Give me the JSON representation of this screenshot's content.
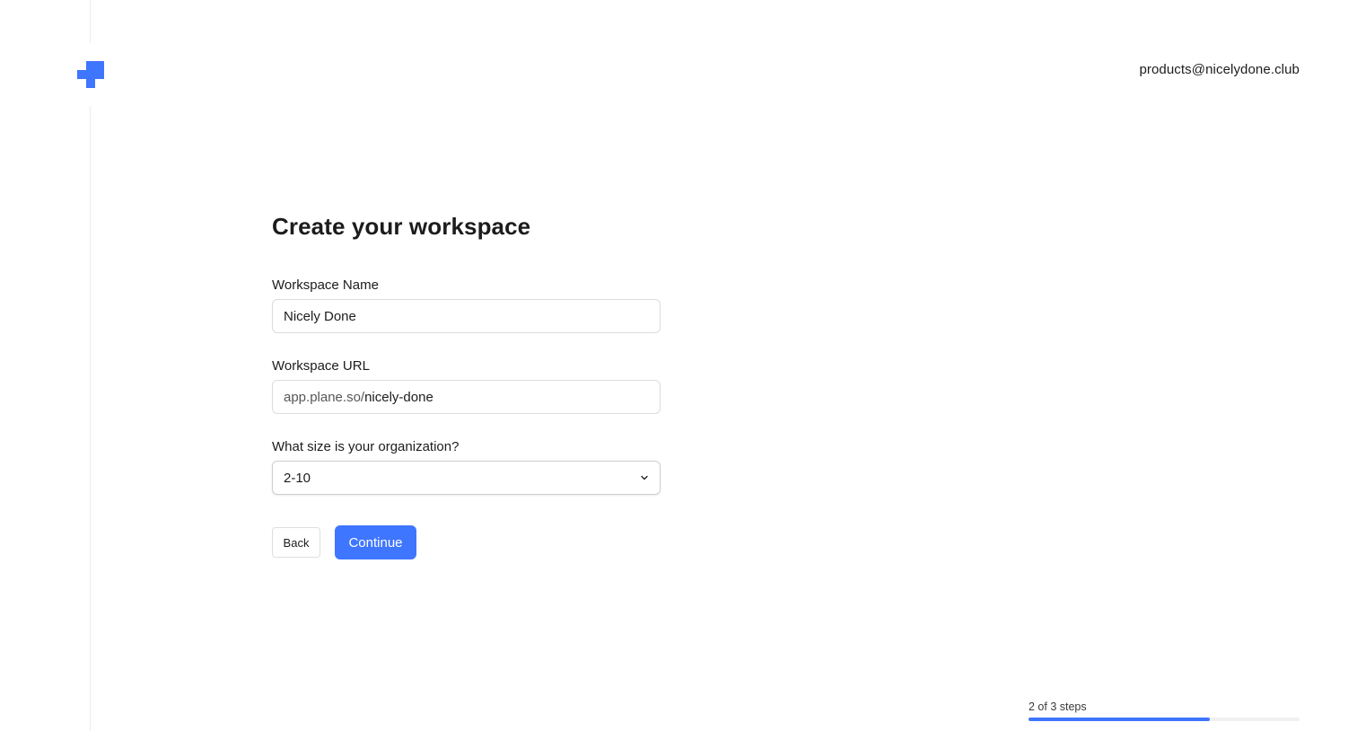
{
  "header": {
    "logo_icon": "plane-logo-icon",
    "user_email": "products@nicelydone.club"
  },
  "form": {
    "title": "Create your workspace",
    "workspace_name": {
      "label": "Workspace Name",
      "value": "Nicely Done"
    },
    "workspace_url": {
      "label": "Workspace URL",
      "prefix": "app.plane.so/",
      "value": "nicely-done"
    },
    "org_size": {
      "label": "What size is your organization?",
      "selected": "2-10",
      "icon": "chevron-down-icon"
    },
    "back_label": "Back",
    "continue_label": "Continue"
  },
  "progress": {
    "text": "2 of 3 steps",
    "current_step": 2,
    "total_steps": 3,
    "fraction": 0.67
  },
  "colors": {
    "accent": "#3f76ff",
    "border": "#dcdcdc",
    "text": "#1c1c1c"
  }
}
